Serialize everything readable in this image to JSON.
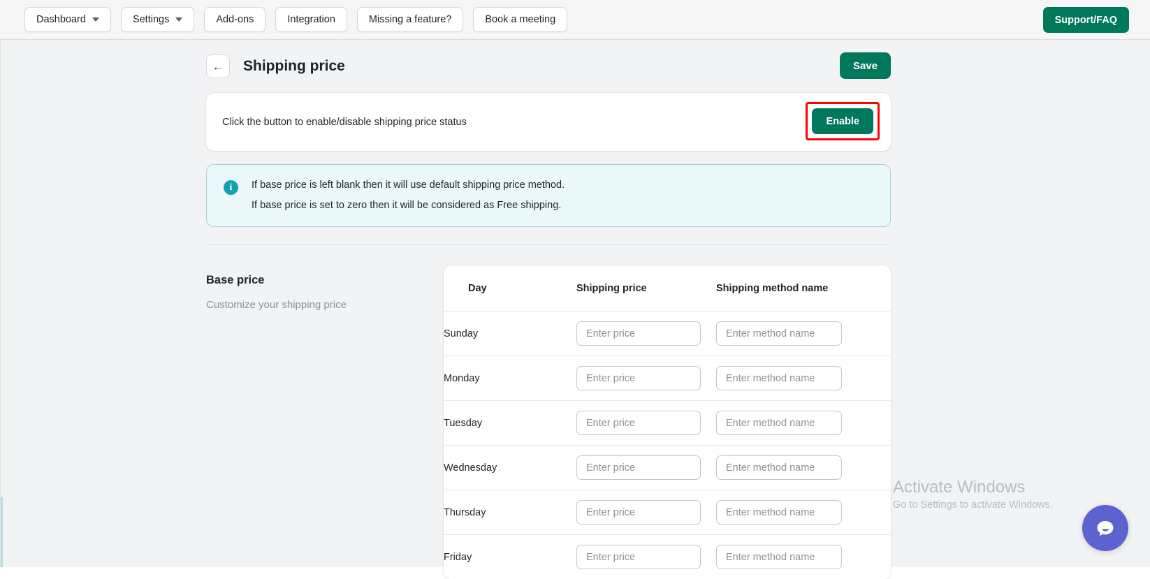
{
  "topbar": {
    "nav": [
      {
        "label": "Dashboard",
        "caret": true,
        "icon": "chevron-down-icon"
      },
      {
        "label": "Settings",
        "caret": true,
        "icon": "chevron-down-icon"
      },
      {
        "label": "Add-ons",
        "caret": false
      },
      {
        "label": "Integration",
        "caret": false
      },
      {
        "label": "Missing a feature?",
        "caret": false
      },
      {
        "label": "Book a meeting",
        "caret": false
      }
    ],
    "support_label": "Support/FAQ"
  },
  "header": {
    "back_icon": "←",
    "title": "Shipping price",
    "save_label": "Save"
  },
  "status_card": {
    "text": "Click the button to enable/disable shipping price status",
    "enable_label": "Enable",
    "highlight_color": "#ff0000"
  },
  "info_banner": {
    "icon": "i",
    "lines": [
      "If base price is left blank then it will use default shipping price method.",
      "If base price is set to zero then it will be considered as Free shipping."
    ]
  },
  "base_price_section": {
    "title": "Base price",
    "subtitle": "Customize your shipping price"
  },
  "table": {
    "columns": [
      "Day",
      "Shipping price",
      "Shipping method name"
    ],
    "price_placeholder": "Enter price",
    "method_placeholder": "Enter method name",
    "rows": [
      {
        "day": "Sunday",
        "price": "",
        "method": ""
      },
      {
        "day": "Monday",
        "price": "",
        "method": ""
      },
      {
        "day": "Tuesday",
        "price": "",
        "method": ""
      },
      {
        "day": "Wednesday",
        "price": "",
        "method": ""
      },
      {
        "day": "Thursday",
        "price": "",
        "method": ""
      },
      {
        "day": "Friday",
        "price": "",
        "method": ""
      }
    ]
  },
  "watermark": {
    "title": "Activate Windows",
    "subtitle": "Go to Settings to activate Windows."
  },
  "chat": {
    "icon": "chat-bubble-icon",
    "color": "#5c62cf"
  },
  "colors": {
    "brand_green": "#00785c",
    "info_bg": "#eaf7fb",
    "info_icon": "#13a0b2",
    "page_bg": "#f2f3f4"
  }
}
